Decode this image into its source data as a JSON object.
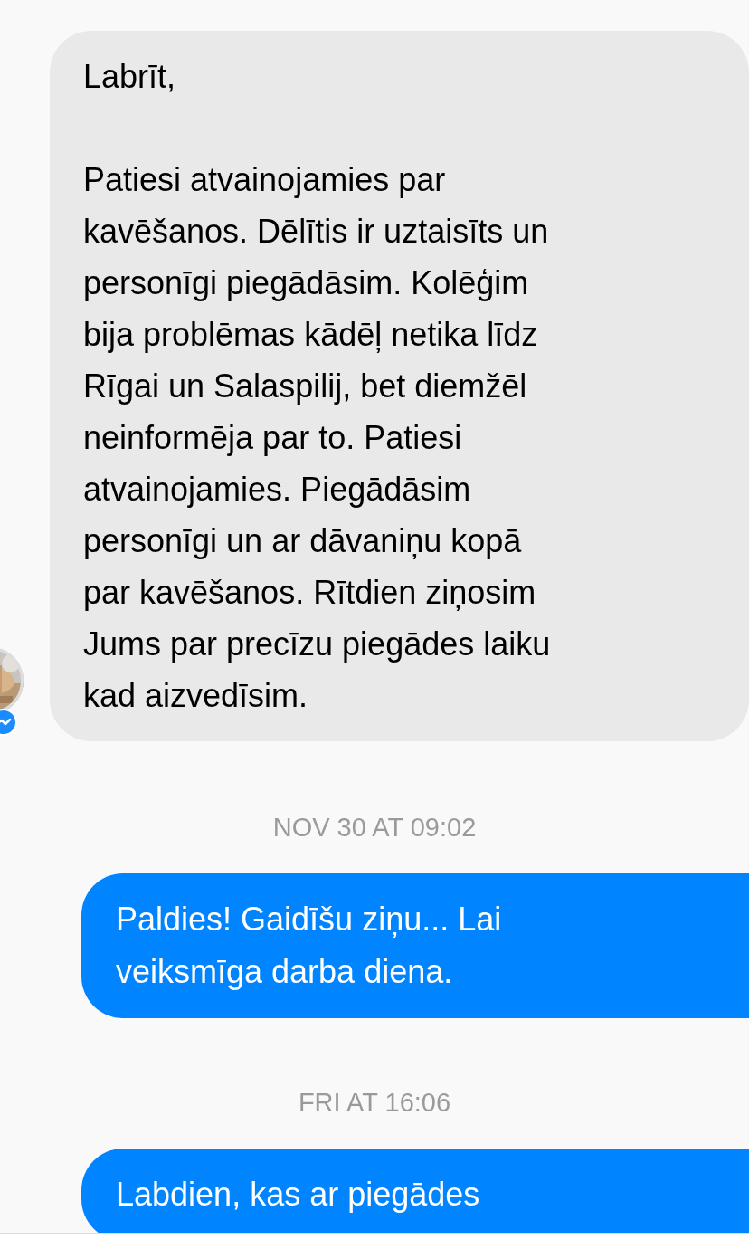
{
  "messages": [
    {
      "kind": "incoming",
      "text": "Labrīt,\n\nPatiesi atvainojamies par\nkavēšanos. Dēlītis ir uztaisīts un\npersonīgi piegādāsim. Kolēģim\nbija problēmas kādēļ netika līdz\nRīgai un Salaspilij, bet diemžēl\nneinformēja par to. Patiesi\natvainojamies. Piegādāsim\npersonīgi un ar dāvaniņu kopā\npar kavēšanos. Rītdien ziņosim\nJums par precīzu piegādes laiku\nkad aizvedīsim."
    },
    {
      "kind": "timestamp",
      "text": "NOV 30 AT 09:02"
    },
    {
      "kind": "outgoing",
      "text": "Paldies! Gaidīšu ziņu... Lai\nveiksmīga darba diena."
    },
    {
      "kind": "timestamp",
      "text": "FRI AT 16:06"
    },
    {
      "kind": "outgoing",
      "text": "Labdien, kas ar piegādes"
    }
  ]
}
